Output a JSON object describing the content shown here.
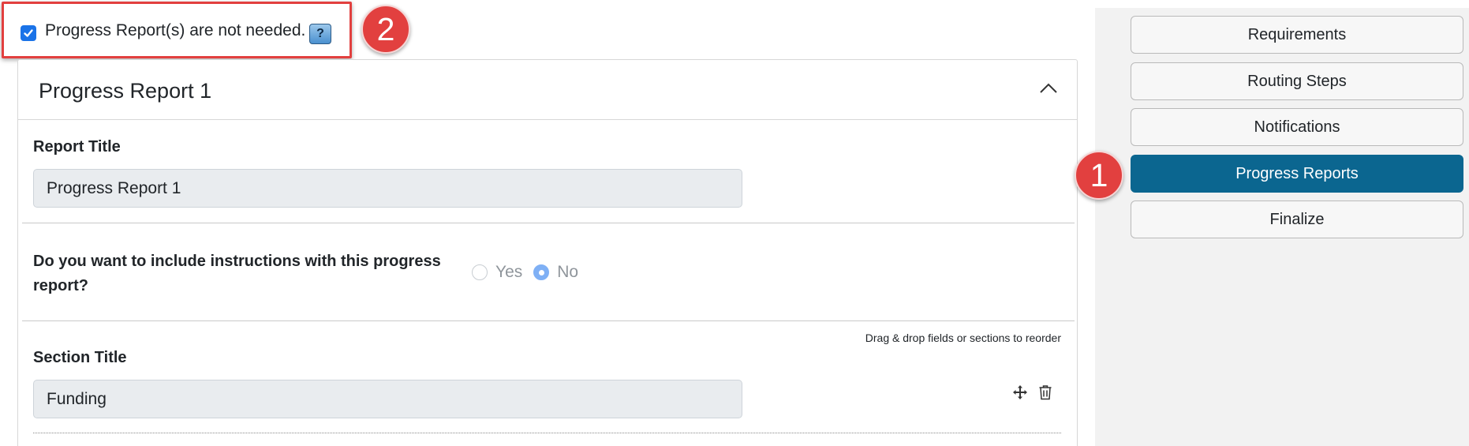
{
  "not_needed": {
    "label": "Progress Report(s) are not needed.",
    "checked": true,
    "help_label": "?",
    "callout_number": "2"
  },
  "card": {
    "title": "Progress Report 1",
    "report_title_label": "Report Title",
    "report_title_value": "Progress Report 1",
    "instructions_question": "Do you want to include instructions with this progress report?",
    "instructions_options": [
      "Yes",
      "No"
    ],
    "instructions_selected": "No",
    "reorder_hint": "Drag & drop fields or sections to reorder",
    "section_title_label": "Section Title",
    "section_title_value": "Funding"
  },
  "sidebar": {
    "callout_number": "1",
    "items": [
      {
        "label": "Requirements",
        "active": false
      },
      {
        "label": "Routing Steps",
        "active": false
      },
      {
        "label": "Notifications",
        "active": false
      },
      {
        "label": "Progress Reports",
        "active": true
      },
      {
        "label": "Finalize",
        "active": false
      }
    ]
  },
  "colors": {
    "accent": "#0b6690",
    "callout": "#e2403f",
    "checkbox": "#1a73e8"
  }
}
